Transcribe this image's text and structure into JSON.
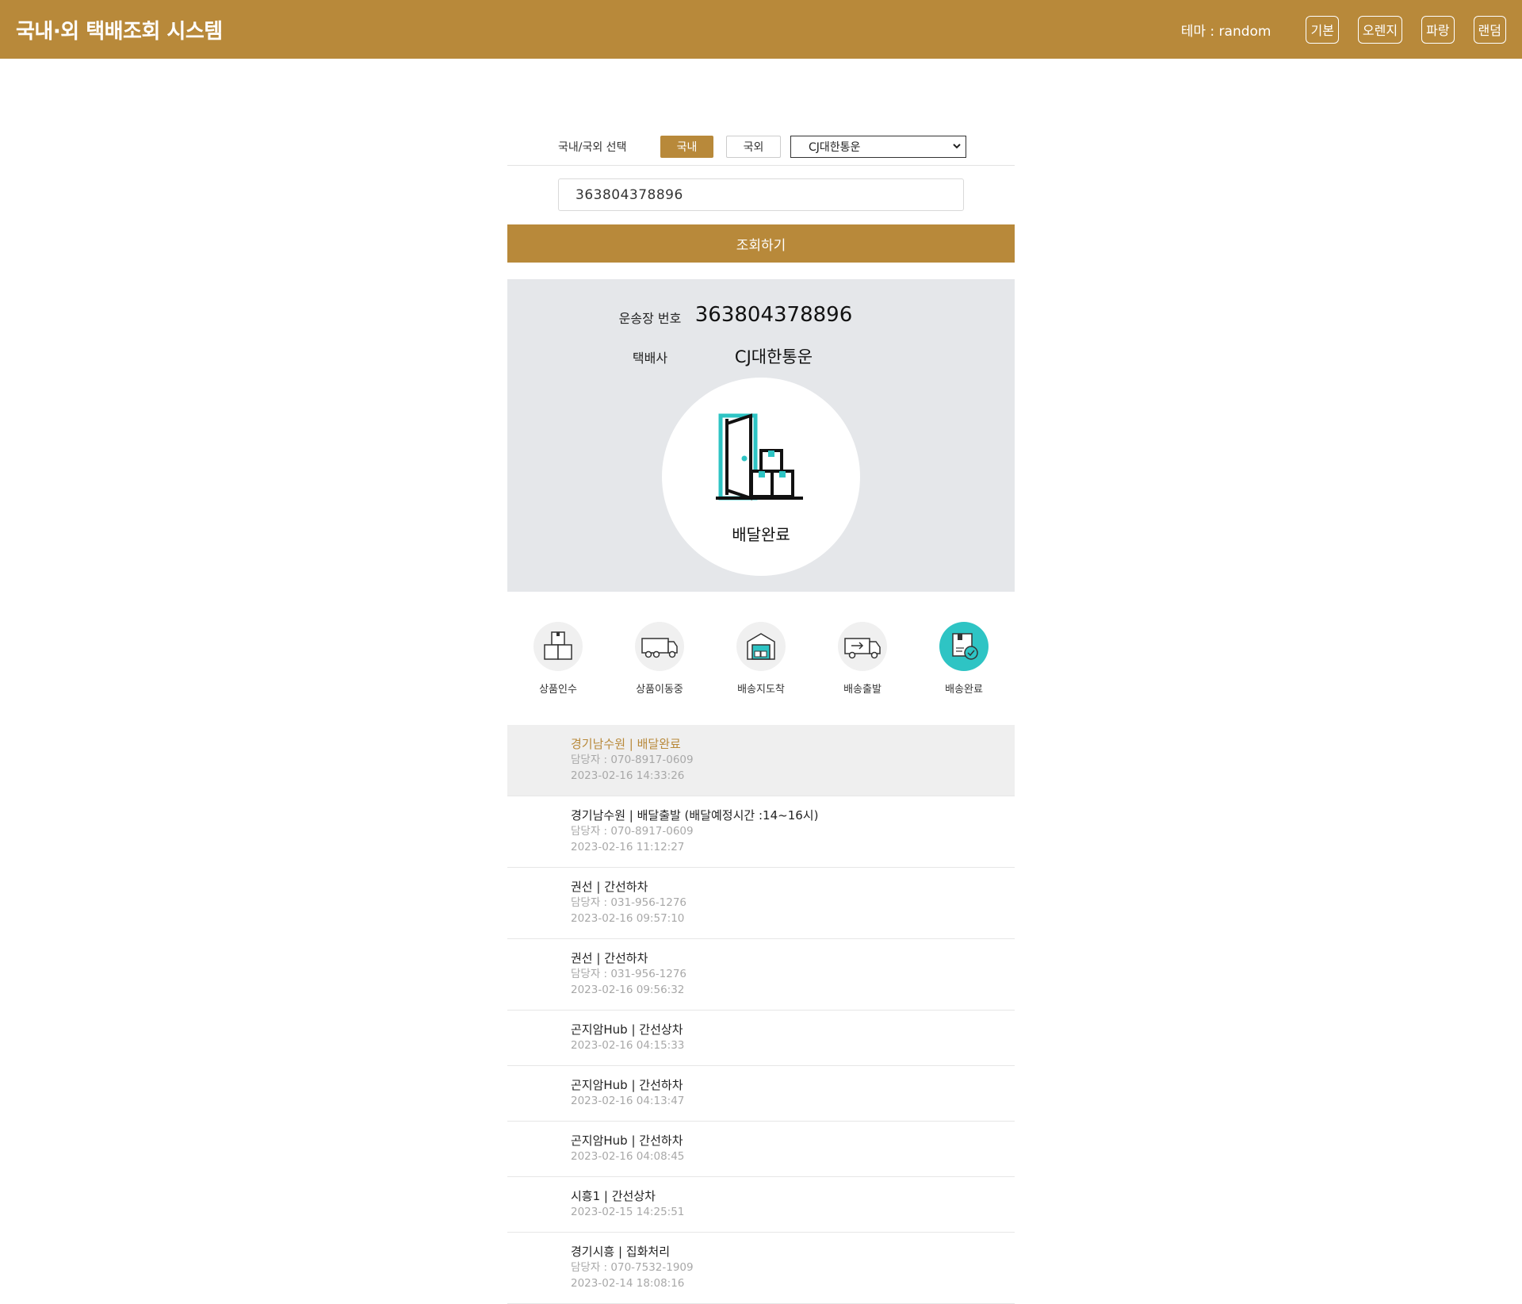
{
  "header": {
    "title": "국내·외 택배조회 시스템",
    "theme_label": "테마 : random",
    "theme_buttons": [
      "기본",
      "오렌지",
      "파랑",
      "랜덤"
    ],
    "accent_color": "#b8893a"
  },
  "search": {
    "selector_label": "국내/국외 선택",
    "domestic_label": "국내",
    "international_label": "국외",
    "carrier_selected": "CJ대한통운",
    "tracking_number": "363804378896",
    "submit_label": "조회하기"
  },
  "result": {
    "waybill_label": "운송장 번호",
    "waybill_value": "363804378896",
    "carrier_label": "택배사",
    "carrier_value": "CJ대한통운",
    "status_label": "배달완료",
    "status_color": "#2ec4c4"
  },
  "steps": [
    {
      "label": "상품인수",
      "icon": "boxes-icon",
      "active": false
    },
    {
      "label": "상품이동중",
      "icon": "truck-icon",
      "active": false
    },
    {
      "label": "배송지도착",
      "icon": "warehouse-icon",
      "active": false
    },
    {
      "label": "배송출발",
      "icon": "delivery-van-icon",
      "active": false
    },
    {
      "label": "배송완료",
      "icon": "package-check-icon",
      "active": true
    }
  ],
  "events": [
    {
      "title": "경기남수원 | 배달완료",
      "contact": "담당자 : 070-8917-0609",
      "time": "2023-02-16 14:33:26"
    },
    {
      "title": "경기남수원 | 배달출발 (배달예정시간 :14~16시)",
      "contact": "담당자 : 070-8917-0609",
      "time": "2023-02-16 11:12:27"
    },
    {
      "title": "권선 | 간선하차",
      "contact": "담당자 : 031-956-1276",
      "time": "2023-02-16 09:57:10"
    },
    {
      "title": "권선 | 간선하차",
      "contact": "담당자 : 031-956-1276",
      "time": "2023-02-16 09:56:32"
    },
    {
      "title": "곤지암Hub | 간선상차",
      "time": "2023-02-16 04:15:33"
    },
    {
      "title": "곤지암Hub | 간선하차",
      "time": "2023-02-16 04:13:47"
    },
    {
      "title": "곤지암Hub | 간선하차",
      "time": "2023-02-16 04:08:45"
    },
    {
      "title": "시흥1 | 간선상차",
      "time": "2023-02-15 14:25:51"
    },
    {
      "title": "경기시흥 | 집화처리",
      "contact": "담당자 : 070-7532-1909",
      "time": "2023-02-14 18:08:16"
    }
  ]
}
